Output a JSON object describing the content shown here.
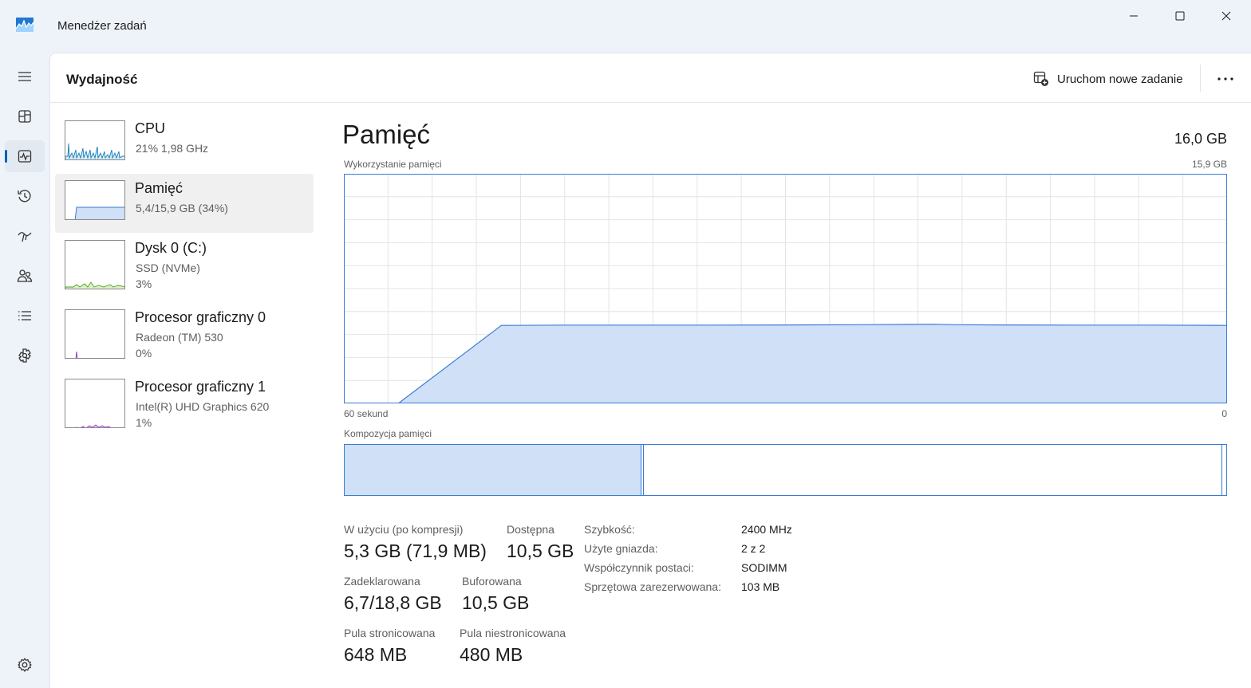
{
  "app": {
    "title": "Menedżer zadań",
    "accent_color": "#005fb8"
  },
  "window_controls": [
    "minimize-icon",
    "maximize-icon",
    "close-icon"
  ],
  "nav": {
    "items": [
      {
        "icon": "hamburger-icon",
        "active": false
      },
      {
        "icon": "processes-icon",
        "active": false
      },
      {
        "icon": "performance-icon",
        "active": true
      },
      {
        "icon": "app-history-icon",
        "active": false
      },
      {
        "icon": "startup-apps-icon",
        "active": false
      },
      {
        "icon": "users-icon",
        "active": false
      },
      {
        "icon": "details-icon",
        "active": false
      },
      {
        "icon": "services-icon",
        "active": false
      }
    ],
    "settings_icon": "gear-icon"
  },
  "header": {
    "title": "Wydajność",
    "run_task_label": "Uruchom nowe zadanie"
  },
  "resources": [
    {
      "name": "CPU",
      "sub1": "21%  1,98 GHz",
      "sub2": "",
      "color": "#117dbb"
    },
    {
      "name": "Pamięć",
      "sub1": "5,4/15,9 GB (34%)",
      "sub2": "",
      "color": "#3a7bd5",
      "selected": true
    },
    {
      "name": "Dysk 0 (C:)",
      "sub1": "SSD (NVMe)",
      "sub2": "3%",
      "color": "#4da60c"
    },
    {
      "name": "Procesor graficzny 0",
      "sub1": "Radeon (TM) 530",
      "sub2": "0%",
      "color": "#8e2ad6"
    },
    {
      "name": "Procesor graficzny 1",
      "sub1": "Intel(R) UHD Graphics 620",
      "sub2": "1%",
      "color": "#8e2ad6"
    }
  ],
  "detail": {
    "title": "Pamięć",
    "total": "16,0 GB",
    "usage_label": "Wykorzystanie pamięci",
    "usage_max": "15,9 GB",
    "time_left": "60 sekund",
    "time_right": "0",
    "composition_label": "Kompozycja pamięci",
    "composition": {
      "in_use_fraction": 0.337,
      "modified_fraction": 0.003,
      "standby_fraction": 0.655,
      "free_fraction": 0.005
    }
  },
  "chart_data": {
    "type": "area",
    "title": "Wykorzystanie pamięci",
    "x_range_seconds": [
      60,
      0
    ],
    "ylim_gb": [
      0,
      15.9
    ],
    "color": "#3a7bd5",
    "fill": "#cfe0f7",
    "x": [
      60,
      56.3,
      49.3,
      45,
      40,
      35,
      30,
      25,
      20,
      18.5,
      15,
      10,
      5,
      0
    ],
    "y": [
      0,
      0,
      5.4,
      5.42,
      5.42,
      5.42,
      5.43,
      5.45,
      5.48,
      5.45,
      5.43,
      5.42,
      5.42,
      5.4
    ]
  },
  "stats": {
    "in_use_label": "W użyciu (po kompresji)",
    "in_use_value": "5,3 GB (71,9 MB)",
    "available_label": "Dostępna",
    "available_value": "10,5 GB",
    "committed_label": "Zadeklarowana",
    "committed_value": "6,7/18,8 GB",
    "cached_label": "Buforowana",
    "cached_value": "10,5 GB",
    "paged_label": "Pula stronicowana",
    "paged_value": "648 MB",
    "nonpaged_label": "Pula niestronicowana",
    "nonpaged_value": "480 MB"
  },
  "specs": [
    {
      "key": "Szybkość:",
      "value": "2400 MHz"
    },
    {
      "key": "Użyte gniazda:",
      "value": "2 z 2"
    },
    {
      "key": "Współczynnik postaci:",
      "value": "SODIMM"
    },
    {
      "key": "Sprzętowa zarezerwowana:",
      "value": "103 MB"
    }
  ]
}
